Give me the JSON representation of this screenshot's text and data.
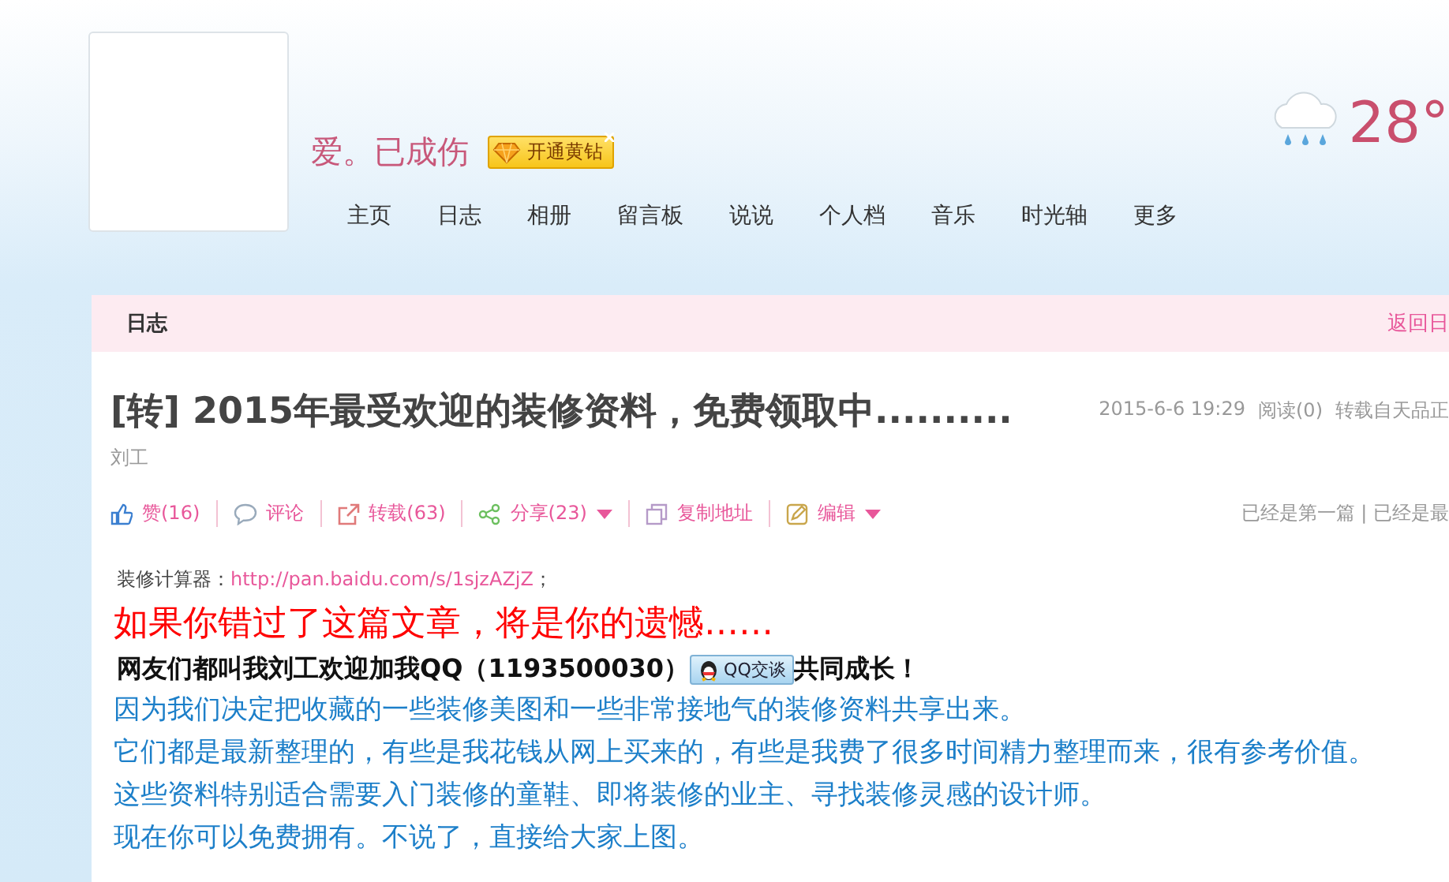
{
  "profile": {
    "name": "爱。已成伤",
    "vip_badge": "开通黄钻"
  },
  "nav": [
    {
      "label": "主页"
    },
    {
      "label": "日志"
    },
    {
      "label": "相册"
    },
    {
      "label": "留言板"
    },
    {
      "label": "说说"
    },
    {
      "label": "个人档"
    },
    {
      "label": "音乐"
    },
    {
      "label": "时光轴"
    },
    {
      "label": "更多"
    }
  ],
  "weather": {
    "temperature": "28°"
  },
  "panel": {
    "title": "日志",
    "back_link": "返回日"
  },
  "post": {
    "title": "[转] 2015年最受欢迎的装修资料，免费领取中..........",
    "date": "2015-6-6 19:29",
    "reads": "阅读(0)",
    "source": "转载自天品正",
    "author": "刘工",
    "actions": [
      {
        "kind": "like",
        "label": "赞(16)",
        "dropdown": false
      },
      {
        "kind": "comment",
        "label": "评论",
        "dropdown": false
      },
      {
        "kind": "forward",
        "label": "转载(63)",
        "dropdown": false
      },
      {
        "kind": "share",
        "label": "分享(23)",
        "dropdown": true
      },
      {
        "kind": "copy",
        "label": "复制地址",
        "dropdown": false
      },
      {
        "kind": "edit",
        "label": "编辑",
        "dropdown": true
      }
    ],
    "pager": "已经是第一篇 | 已经是最",
    "body": {
      "calc_label": "装修计算器：",
      "calc_link": "http://pan.baidu.com/s/1sjzAZjZ",
      "calc_end": "；",
      "headline": "如果你错过了这篇文章，将是你的遗憾……",
      "qq_line": "网友们都叫我刘工欢迎加我QQ（1193500030）",
      "qq_button": "QQ交谈",
      "qq_end": "共同成长！",
      "paragraphs": [
        "因为我们决定把收藏的一些装修美图和一些非常接地气的装修资料共享出来。",
        "它们都是最新整理的，有些是我花钱从网上买来的，有些是我费了很多时间精力整理而来，很有参考价值。",
        "这些资料特别适合需要入门装修的童鞋、即将装修的业主、寻找装修灵感的设计师。",
        "现在你可以免费拥有。不说了，直接给大家上图。"
      ]
    }
  }
}
